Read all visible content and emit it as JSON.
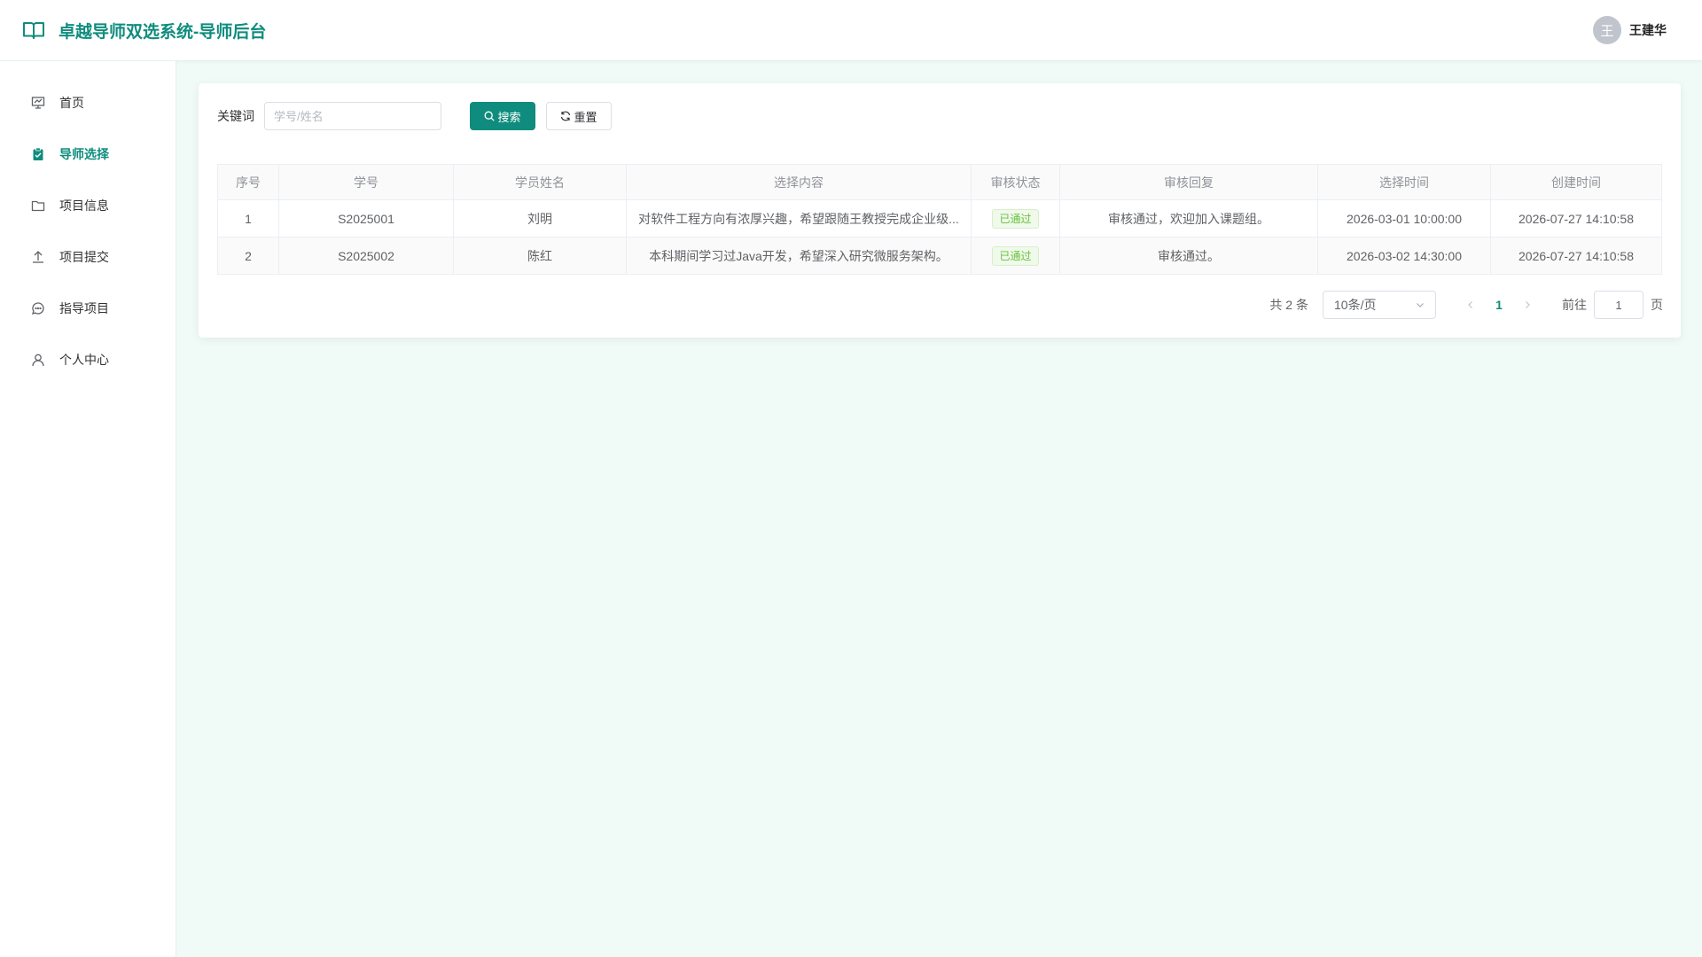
{
  "app": {
    "title": "卓越导师双选系统-导师后台"
  },
  "user": {
    "avatar_text": "王",
    "name": "王建华"
  },
  "sidebar": {
    "items": [
      {
        "label": "首页",
        "icon": "presentation-icon",
        "active": false
      },
      {
        "label": "导师选择",
        "icon": "clipboard-check-icon",
        "active": true
      },
      {
        "label": "项目信息",
        "icon": "folder-icon",
        "active": false
      },
      {
        "label": "项目提交",
        "icon": "upload-icon",
        "active": false
      },
      {
        "label": "指导项目",
        "icon": "chat-icon",
        "active": false
      },
      {
        "label": "个人中心",
        "icon": "user-icon",
        "active": false
      }
    ]
  },
  "search": {
    "label": "关键词",
    "placeholder": "学号/姓名",
    "value": "",
    "search_button": "搜索",
    "reset_button": "重置"
  },
  "table": {
    "columns": [
      "序号",
      "学号",
      "学员姓名",
      "选择内容",
      "审核状态",
      "审核回复",
      "选择时间",
      "创建时间"
    ],
    "rows": [
      {
        "index": "1",
        "student_id": "S2025001",
        "name": "刘明",
        "content": "对软件工程方向有浓厚兴趣，希望跟随王教授完成企业级...",
        "status": "已通过",
        "reply": "审核通过，欢迎加入课题组。",
        "select_time": "2026-03-01 10:00:00",
        "create_time": "2026-07-27 14:10:58"
      },
      {
        "index": "2",
        "student_id": "S2025002",
        "name": "陈红",
        "content": "本科期间学习过Java开发，希望深入研究微服务架构。",
        "status": "已通过",
        "reply": "审核通过。",
        "select_time": "2026-03-02 14:30:00",
        "create_time": "2026-07-27 14:10:58"
      }
    ]
  },
  "pagination": {
    "total_text": "共 2 条",
    "page_size": "10条/页",
    "current_page": "1",
    "goto_label": "前往",
    "goto_value": "1",
    "page_suffix": "页"
  },
  "colors": {
    "accent": "#0f8c7d",
    "success": "#67c23a",
    "background": "#f0fbf8"
  }
}
